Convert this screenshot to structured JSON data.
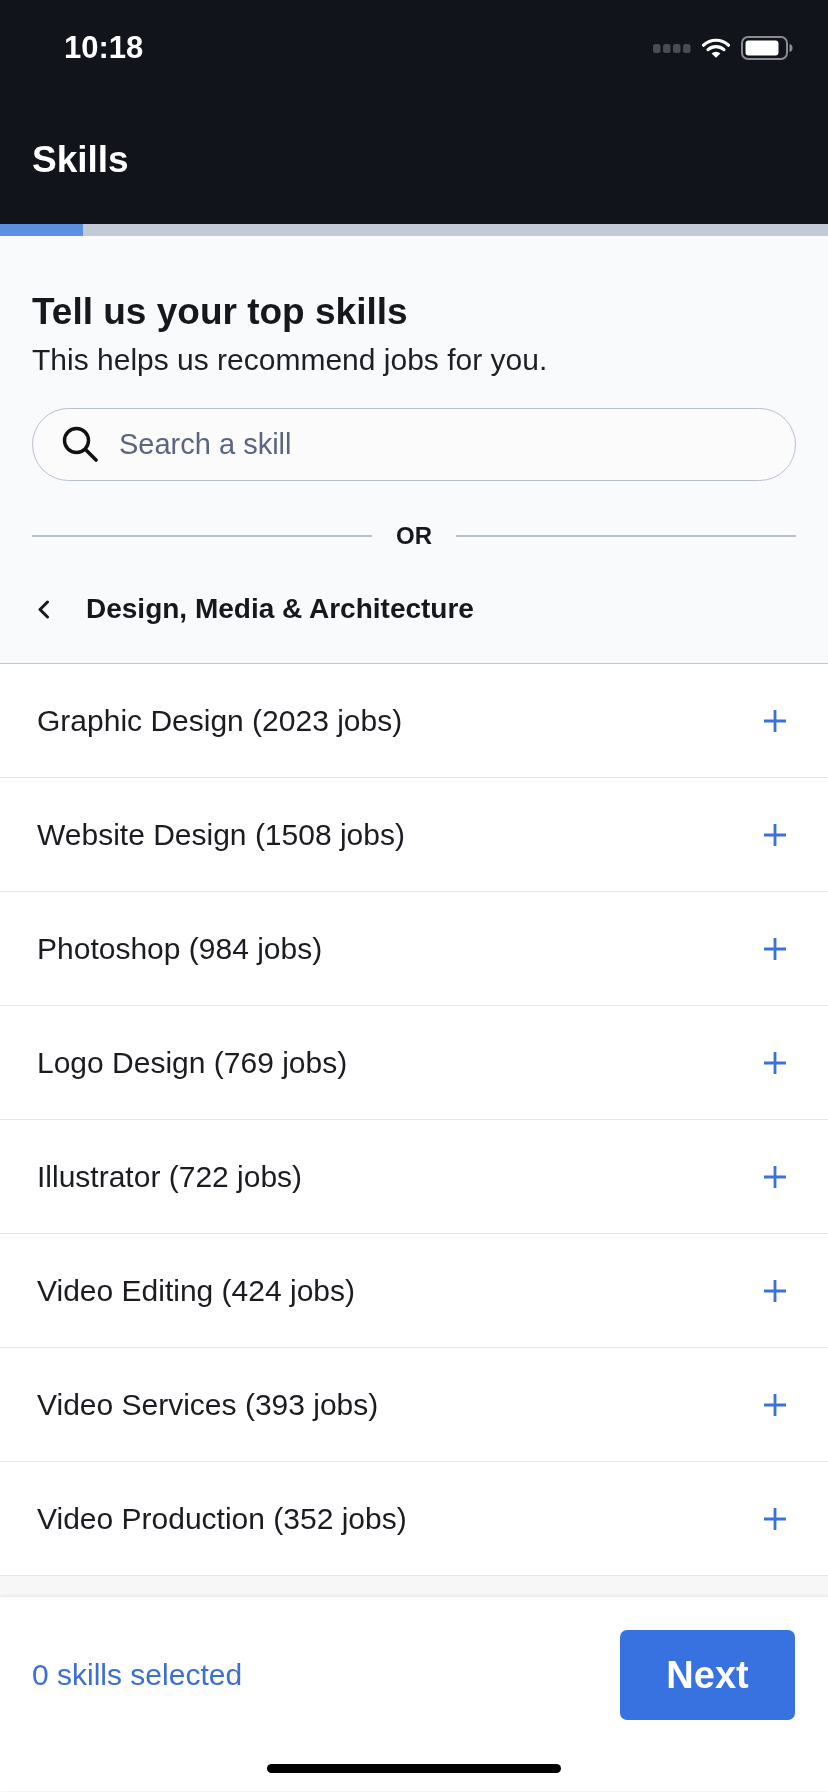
{
  "status_bar": {
    "time": "10:18"
  },
  "header": {
    "title": "Skills"
  },
  "progress": {
    "level": 0.1
  },
  "intro": {
    "heading": "Tell us your top skills",
    "subheading": "This helps us recommend jobs for you."
  },
  "search": {
    "placeholder": "Search a skill"
  },
  "divider": {
    "label": "OR"
  },
  "category": {
    "title": "Design, Media & Architecture"
  },
  "skills": [
    {
      "name": "Graphic Design (2023 jobs)",
      "selected": false
    },
    {
      "name": "Website Design (1508 jobs)",
      "selected": false
    },
    {
      "name": "Photoshop (984 jobs)",
      "selected": false
    },
    {
      "name": "Logo Design (769 jobs)",
      "selected": false
    },
    {
      "name": "Illustrator (722 jobs)",
      "selected": false
    },
    {
      "name": "Video Editing (424 jobs)",
      "selected": false
    },
    {
      "name": "Video Services (393 jobs)",
      "selected": false
    },
    {
      "name": "Video Production (352 jobs)",
      "selected": false
    }
  ],
  "footer": {
    "selection_count": "0 skills selected",
    "next_button": "Next"
  }
}
